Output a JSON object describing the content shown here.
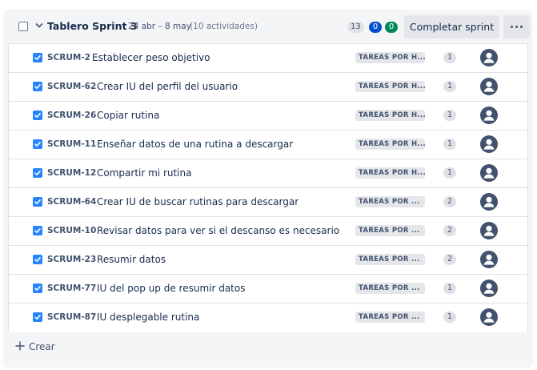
{
  "sprint": {
    "title": "Tablero Sprint 3",
    "dates": "24 abr – 8 may",
    "activity_count": "(10 actividades)",
    "counts": {
      "todo": "13",
      "in_progress": "0",
      "done": "0"
    },
    "complete_button": "Completar sprint",
    "colors": {
      "todo": "#dfe1e6",
      "in_progress": "#0052cc",
      "done": "#00875a"
    }
  },
  "issues": [
    {
      "key": "SCRUM-2",
      "summary": "Establecer peso objetivo",
      "status": "TAREAS POR H...",
      "points": "1",
      "checked": true
    },
    {
      "key": "SCRUM-62",
      "summary": "Crear IU del perfil del usuario",
      "status": "TAREAS POR H...",
      "points": "1",
      "checked": true
    },
    {
      "key": "SCRUM-26",
      "summary": "Copiar rutina",
      "status": "TAREAS POR H...",
      "points": "1",
      "checked": true
    },
    {
      "key": "SCRUM-11",
      "summary": "Enseñar datos de una rutina a descargar",
      "status": "TAREAS POR H...",
      "points": "1",
      "checked": true
    },
    {
      "key": "SCRUM-12",
      "summary": "Compartir mi rutina",
      "status": "TAREAS POR H...",
      "points": "1",
      "checked": true
    },
    {
      "key": "SCRUM-64",
      "summary": "Crear IU de buscar rutinas para descargar",
      "status": "TAREAS POR ...",
      "points": "2",
      "checked": true
    },
    {
      "key": "SCRUM-10",
      "summary": "Revisar datos para ver si el descanso es necesario",
      "status": "TAREAS POR ...",
      "points": "2",
      "checked": true
    },
    {
      "key": "SCRUM-23",
      "summary": "Resumir datos",
      "status": "TAREAS POR ...",
      "points": "2",
      "checked": true
    },
    {
      "key": "SCRUM-77",
      "summary": "IU del pop up de resumir datos",
      "status": "TAREAS POR ...",
      "points": "1",
      "checked": true
    },
    {
      "key": "SCRUM-87",
      "summary": "IU desplegable rutina",
      "status": "TAREAS POR ...",
      "points": "1",
      "checked": true
    }
  ],
  "create": {
    "label": "Crear",
    "icon": "plus-icon"
  },
  "icons": {
    "collapse": "chevron-down-icon",
    "more": "more-icon",
    "assignee": "avatar-icon"
  }
}
